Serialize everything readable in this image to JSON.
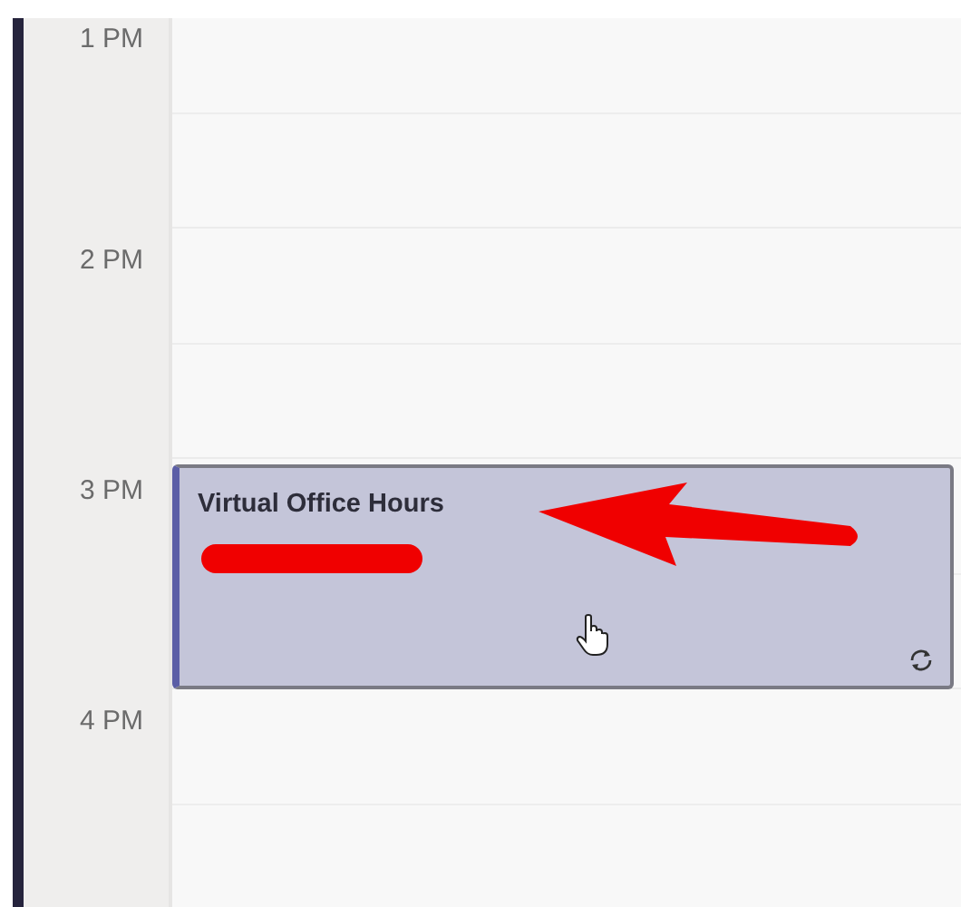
{
  "hours": [
    {
      "label": "1 PM"
    },
    {
      "label": "2 PM"
    },
    {
      "label": "3 PM",
      "events": [
        {
          "title": "Virtual Office Hours",
          "recurring": true
        }
      ]
    },
    {
      "label": "4 PM"
    }
  ]
}
